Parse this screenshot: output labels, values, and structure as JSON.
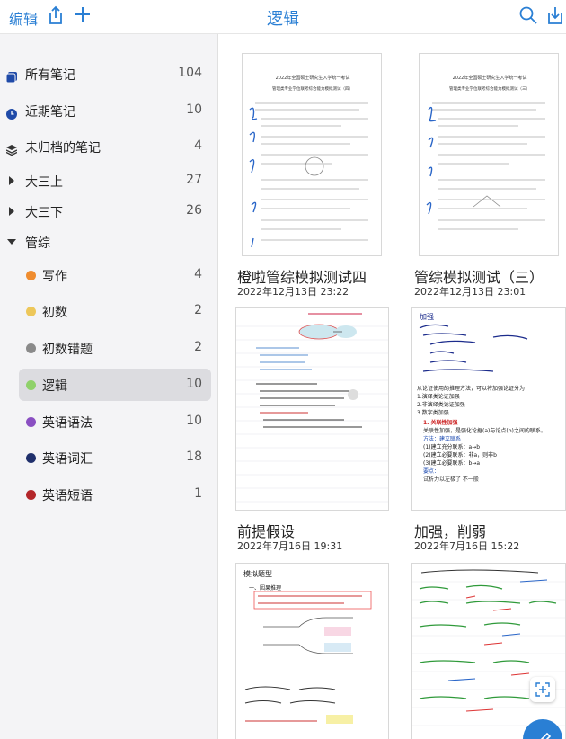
{
  "topbar": {
    "edit_label": "编辑",
    "title": "逻辑"
  },
  "sidebar": {
    "items": [
      {
        "label": "所有笔记",
        "count": "104",
        "icon": "all-notes-icon"
      },
      {
        "label": "近期笔记",
        "count": "10",
        "icon": "recent-clock-icon"
      },
      {
        "label": "未归档的笔记",
        "count": "4",
        "icon": "unarchived-stack-icon"
      },
      {
        "label": "大三上",
        "count": "27",
        "icon": "expand-arrow-icon"
      },
      {
        "label": "大三下",
        "count": "26",
        "icon": "expand-arrow-icon"
      },
      {
        "label": "管综",
        "count": "",
        "icon": "collapse-arrow-icon"
      }
    ],
    "subfolders": [
      {
        "label": "写作",
        "count": "4",
        "color": "#ef8c2f"
      },
      {
        "label": "初数",
        "count": "2",
        "color": "#edc75a"
      },
      {
        "label": "初数错题",
        "count": "2",
        "color": "#8a8a8a"
      },
      {
        "label": "逻辑",
        "count": "10",
        "color": "#8fd16a"
      },
      {
        "label": "英语语法",
        "count": "10",
        "color": "#8a4fc2"
      },
      {
        "label": "英语词汇",
        "count": "18",
        "color": "#1f2f6b"
      },
      {
        "label": "英语短语",
        "count": "1",
        "color": "#b3262a"
      }
    ]
  },
  "notes": [
    {
      "title": "橙啦管综模拟测试四",
      "date": "2022年12月13日 23:22"
    },
    {
      "title": "管综模拟测试（三）",
      "date": "2022年12月13日 23:01"
    },
    {
      "title": "前提假设",
      "date": "2022年7月16日 19:31"
    },
    {
      "title": "加强，削弱",
      "date": "2022年7月16日 15:22"
    },
    {
      "title": "",
      "date": ""
    },
    {
      "title": "",
      "date": ""
    }
  ],
  "thumb_text": {
    "t1_header": "2022年全国硕士研究生入学统一考试",
    "t1_sub": "管理类专业学位联考综合能力模拟测试（四）",
    "t2_header": "2022年全国硕士研究生入学统一考试",
    "t2_sub": "管理类专业学位联考综合能力模拟测试（三）",
    "t4_lines": [
      "加强",
      "从论证使用的推理方法，可以将加强论证分为：",
      "1.演绎类论证加强",
      "2.非演绎类论证加强",
      "3.数字类加强",
      "1. 关联性加强",
      "关联性加强，是强化论据(a)与论点(b)之间的联系。",
      "方法：建立联系",
      "(1)建立充分联系：a→b",
      "(2)建立必要联系：非a，则非b",
      "(3)建立必要联系：b→a",
      "要点：",
      "试析力以左极了 不一般"
    ],
    "t5_lines": [
      "模拟题型",
      "一、因果推理",
      "原因 → 结果",
      "控制前提 判断"
    ],
    "t6_lines": [
      "斜 削弱 是 新国的 高 力 年 论 文 的 意 义 合 论 题",
      "因果削弱 判 断",
      "不相容 选 项 判 断",
      "大前提 结果 削弱"
    ]
  }
}
